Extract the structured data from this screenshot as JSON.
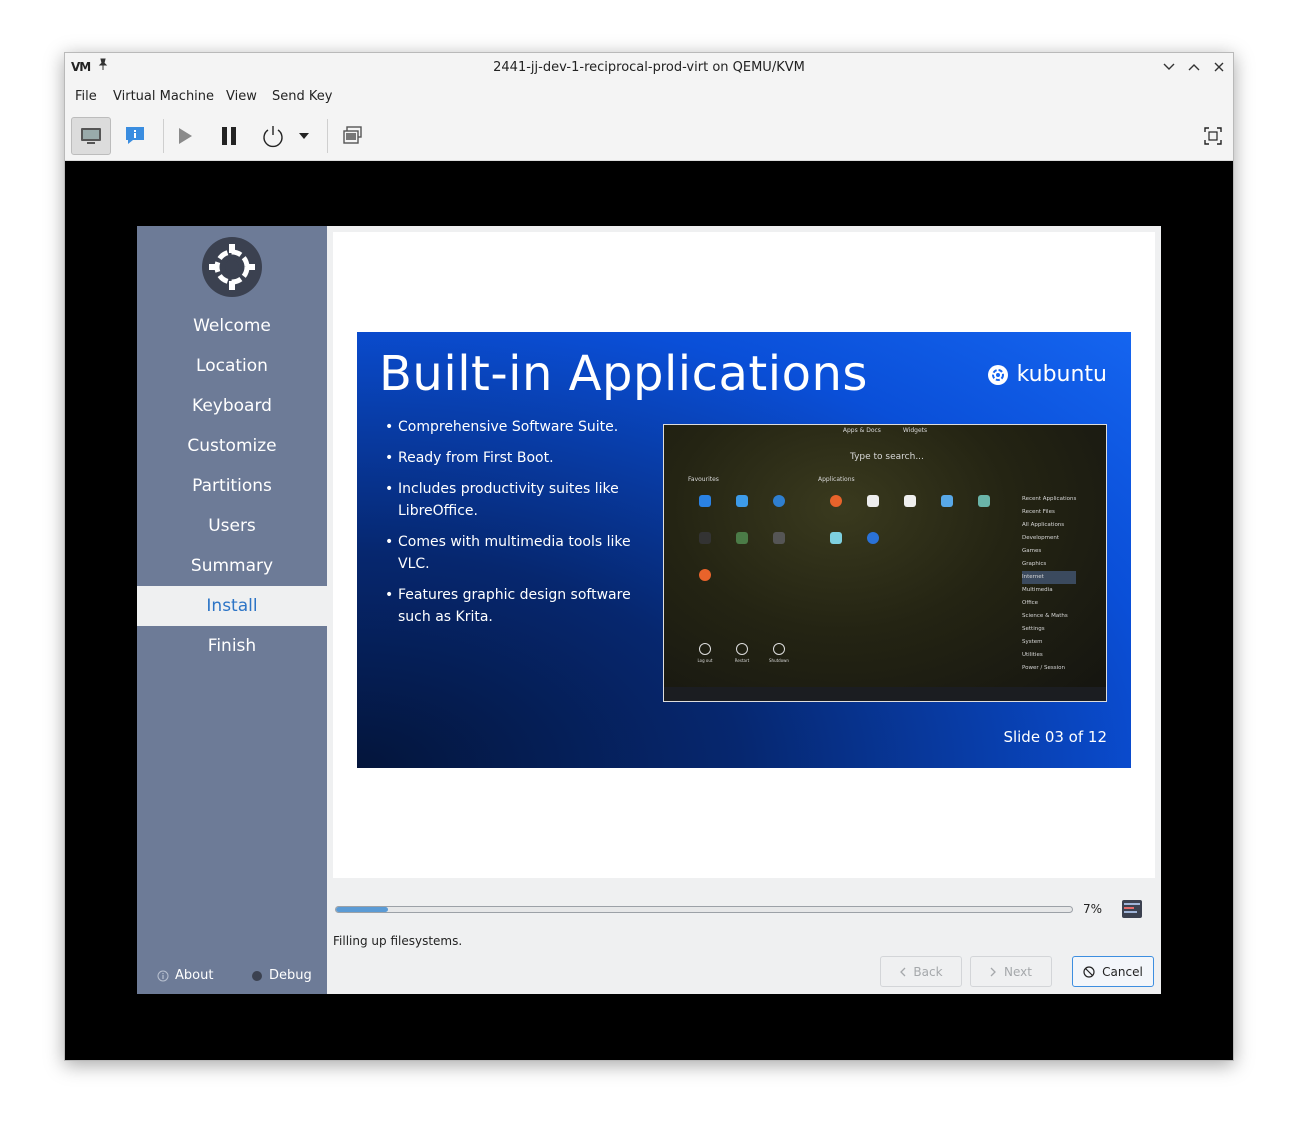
{
  "window": {
    "title": "2441-jj-dev-1-reciprocal-prod-virt on QEMU/KVM",
    "logo_text": "VM"
  },
  "menu": [
    "File",
    "Virtual Machine",
    "View",
    "Send Key"
  ],
  "toolbar": {
    "buttons": [
      "console-view",
      "details-view",
      "run",
      "pause",
      "shutdown",
      "shutdown-menu",
      "snapshots",
      "fullscreen"
    ],
    "active": "console-view"
  },
  "installer": {
    "steps": [
      "Welcome",
      "Location",
      "Keyboard",
      "Customize",
      "Partitions",
      "Users",
      "Summary",
      "Install",
      "Finish"
    ],
    "current_step": "Install",
    "about_label": "About",
    "debug_label": "Debug",
    "slide": {
      "title": "Built-in Applications",
      "brand": "kubuntu",
      "bullets": [
        "Comprehensive Software Suite.",
        "Ready from First Boot.",
        "Includes productivity suites like LibreOffice.",
        "Comes with multimedia tools like VLC.",
        "Features graphic design software such as Krita."
      ],
      "counter": "Slide 03 of 12",
      "screenshot": {
        "tabs": [
          "Apps & Docs",
          "Widgets"
        ],
        "search_placeholder": "Type to search...",
        "favourites_label": "Favourites",
        "applications_label": "Applications",
        "categories": [
          "Recent Applications",
          "Recent Files",
          "All Applications",
          "Development",
          "Games",
          "Graphics",
          "Internet",
          "Multimedia",
          "Office",
          "Science & Maths",
          "Settings",
          "System",
          "Utilities",
          "Power / Session"
        ],
        "selected_category": "Internet",
        "power_actions": [
          "Log out",
          "Restart",
          "Shutdown"
        ]
      }
    },
    "progress": {
      "value": 0.07,
      "label": "7%"
    },
    "status_text": "Filling up filesystems.",
    "buttons": {
      "back": "Back",
      "next": "Next",
      "cancel": "Cancel"
    },
    "colors": {
      "sidebar": "#6d7b97",
      "accent": "#2c74c6",
      "slide_blue": "#1565f0",
      "progress": "#5b9bd5"
    }
  }
}
